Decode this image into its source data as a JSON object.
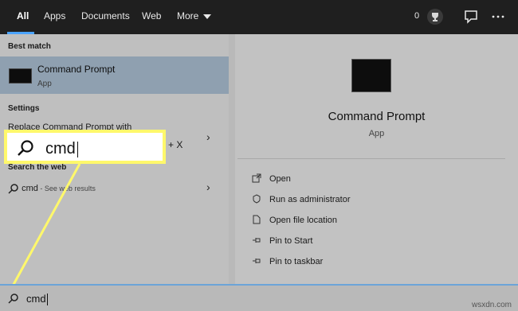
{
  "tabs": [
    "All",
    "Apps",
    "Documents",
    "Web",
    "More"
  ],
  "topbar": {
    "rewards_count": "0"
  },
  "best_match": {
    "section_label": "Best match",
    "title": "Command Prompt",
    "subtitle": "App"
  },
  "settings": {
    "section_label": "Settings",
    "item_label": "Replace Command Prompt with",
    "item_suffix": "+ X"
  },
  "web": {
    "section_label": "Search the web",
    "query": "cmd",
    "hint": " - See web results"
  },
  "detail": {
    "title": "Command Prompt",
    "subtitle": "App",
    "actions": [
      "Open",
      "Run as administrator",
      "Open file location",
      "Pin to Start",
      "Pin to taskbar"
    ]
  },
  "callout": {
    "text": "cmd"
  },
  "search": {
    "value": "cmd"
  },
  "watermark": "wsxdn.com",
  "colors": {
    "callout_border": "#fff86b",
    "highlight": "#8fa0b0",
    "topbar": "#1f1f1f",
    "accent": "#4aa3ff"
  }
}
